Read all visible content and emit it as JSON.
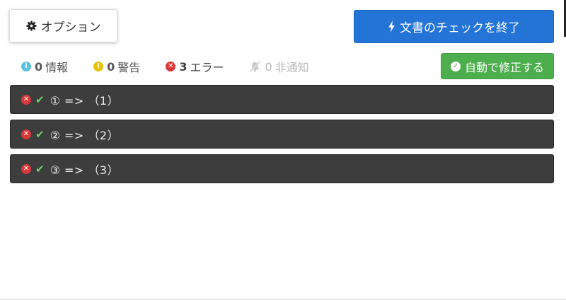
{
  "toolbar": {
    "options_label": "オプション",
    "finish_label": "文書のチェックを終了"
  },
  "filters": [
    {
      "count": "0",
      "label": "情報"
    },
    {
      "count": "0",
      "label": "警告"
    },
    {
      "count": "3",
      "label": "エラー"
    },
    {
      "count": "0",
      "label": "非通知"
    }
  ],
  "autofix": {
    "label": "自動で修正する"
  },
  "rows": [
    {
      "text": "① => （1）"
    },
    {
      "text": "② => （2）"
    },
    {
      "text": "③ => （3）"
    }
  ],
  "icons": {
    "options": "gear-icon",
    "finish": "lightning-bolt-icon",
    "info": "info-circle-icon",
    "warning": "exclamation-circle-icon",
    "error": "x-circle-icon",
    "muted": "bell-slash-icon",
    "autofix": "check-circle-icon",
    "row_error": "x-circle-icon",
    "row_check": "checkmark-icon"
  },
  "colors": {
    "primary": "#2374d6",
    "success": "#4cae4c",
    "info": "#5bc0de",
    "warning": "#e6c200",
    "error": "#d9383a",
    "row_background": "#3d3d3d"
  }
}
